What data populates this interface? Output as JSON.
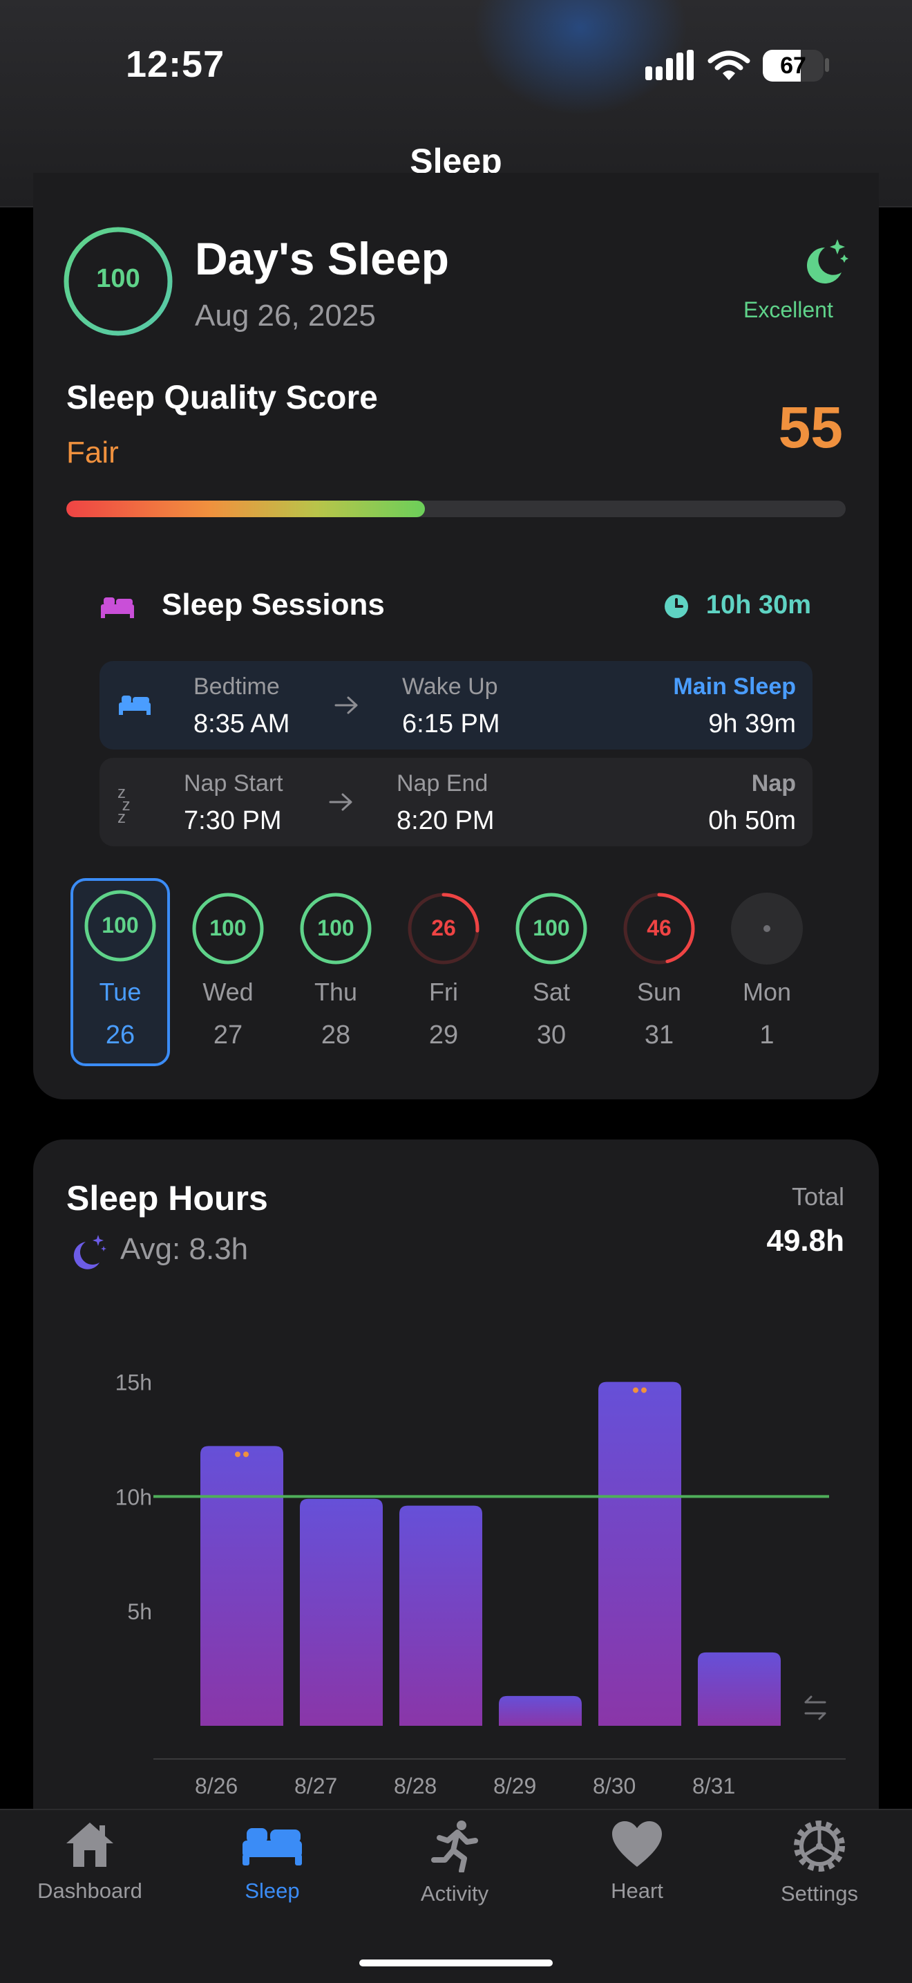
{
  "status": {
    "time": "12:57",
    "battery": "67"
  },
  "header": {
    "title": "Sleep"
  },
  "day_card": {
    "score": "100",
    "title": "Day's Sleep",
    "date": "Aug 26, 2025",
    "rating": "Excellent"
  },
  "quality": {
    "title": "Sleep Quality Score",
    "label": "Fair",
    "score": "55",
    "progress": 0.46
  },
  "sessions": {
    "title": "Sleep Sessions",
    "total": "10h 30m",
    "main": {
      "start_label": "Bedtime",
      "start": "8:35 AM",
      "end_label": "Wake Up",
      "end": "6:15 PM",
      "type": "Main Sleep",
      "duration": "9h 39m"
    },
    "nap": {
      "start_label": "Nap Start",
      "start": "7:30 PM",
      "end_label": "Nap End",
      "end": "8:20 PM",
      "type": "Nap",
      "duration": "0h 50m"
    }
  },
  "days": [
    {
      "score": "100",
      "name": "Tue",
      "num": "26",
      "value": 1.0
    },
    {
      "score": "100",
      "name": "Wed",
      "num": "27",
      "value": 1.0
    },
    {
      "score": "100",
      "name": "Thu",
      "num": "28",
      "value": 1.0
    },
    {
      "score": "26",
      "name": "Fri",
      "num": "29",
      "value": 0.26
    },
    {
      "score": "100",
      "name": "Sat",
      "num": "30",
      "value": 1.0
    },
    {
      "score": "46",
      "name": "Sun",
      "num": "31",
      "value": 0.46
    },
    {
      "score": "",
      "name": "Mon",
      "num": "1",
      "value": 0
    }
  ],
  "sleep_hours": {
    "title": "Sleep Hours",
    "avg": "Avg: 8.3h",
    "total_label": "Total",
    "total": "49.8h"
  },
  "chart_data": {
    "type": "bar",
    "categories": [
      "8/26",
      "8/27",
      "8/28",
      "8/29",
      "8/30",
      "8/31"
    ],
    "values": [
      12.2,
      9.9,
      9.6,
      1.3,
      15.0,
      3.2
    ],
    "yticks": [
      "5h",
      "10h",
      "15h"
    ],
    "ylim": [
      0,
      15.5
    ],
    "reference_line": 10,
    "multi_session": [
      true,
      false,
      false,
      false,
      true,
      false
    ],
    "colors": {
      "bar_top": "#6650d8",
      "bar_bottom": "#8a36a8",
      "reference": "#4fae5a",
      "dots": "#f0913e"
    }
  },
  "tabs": [
    {
      "label": "Dashboard",
      "icon": "house-icon"
    },
    {
      "label": "Sleep",
      "icon": "bed-icon",
      "active": true
    },
    {
      "label": "Activity",
      "icon": "running-icon"
    },
    {
      "label": "Heart",
      "icon": "heart-icon"
    },
    {
      "label": "Settings",
      "icon": "gear-icon"
    }
  ],
  "colors": {
    "accent": "#3b8cf6",
    "green": "#5fd38a",
    "orange": "#f0913e",
    "red": "#ef4444",
    "card": "#1c1c1e"
  }
}
